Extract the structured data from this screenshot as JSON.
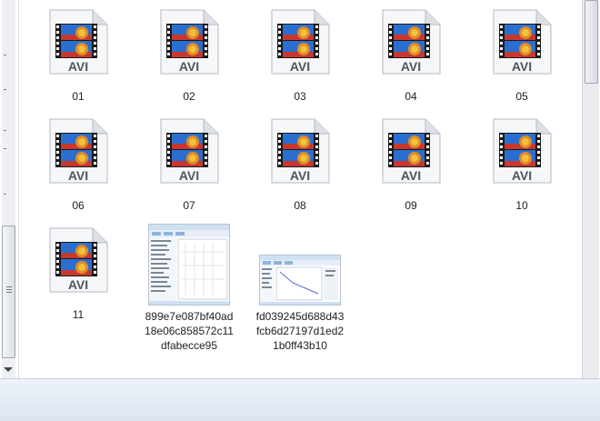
{
  "files": [
    {
      "name": "01",
      "type": "AVI"
    },
    {
      "name": "02",
      "type": "AVI"
    },
    {
      "name": "03",
      "type": "AVI"
    },
    {
      "name": "04",
      "type": "AVI"
    },
    {
      "name": "05",
      "type": "AVI"
    },
    {
      "name": "06",
      "type": "AVI"
    },
    {
      "name": "07",
      "type": "AVI"
    },
    {
      "name": "08",
      "type": "AVI"
    },
    {
      "name": "09",
      "type": "AVI"
    },
    {
      "name": "10",
      "type": "AVI"
    },
    {
      "name": "11",
      "type": "AVI"
    },
    {
      "name": "899e7e087bf40ad18e06c858572c11dfabecce95",
      "type": "image"
    },
    {
      "name": "fd039245d688d43fcb6d27197d1ed21b0ff43b10",
      "type": "image"
    }
  ],
  "icon": "avi-video-file-icon",
  "colors": {
    "statusbar": "#dbe5f1",
    "film": "#1a1a1a",
    "sky": "#2a6fd0",
    "label": "#1e1e1e"
  }
}
